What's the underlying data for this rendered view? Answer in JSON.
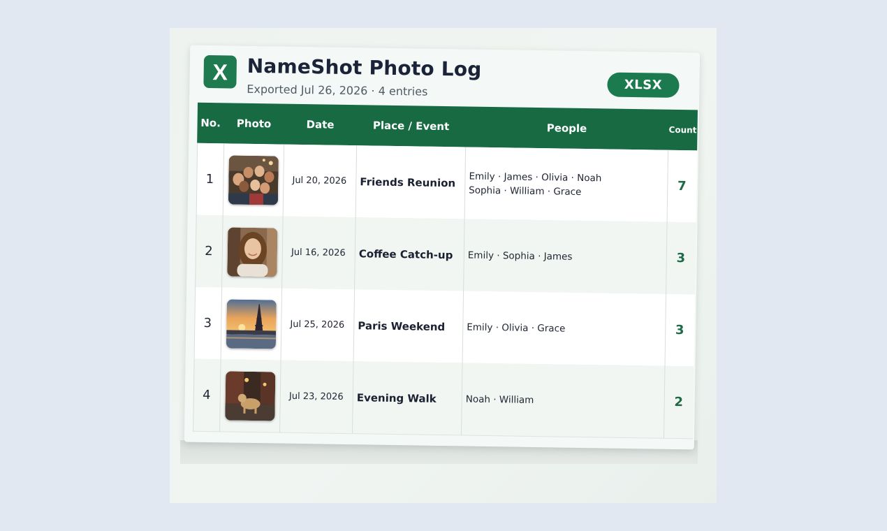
{
  "app": {
    "logo_letter": "X",
    "title": "NameShot Photo Log",
    "subtitle": "Exported Jul 26, 2026 · 4 entries",
    "badge": "XLSX"
  },
  "table": {
    "headers": {
      "no": "No.",
      "photo": "Photo",
      "date": "Date",
      "place": "Place / Event",
      "people": "People",
      "count": "Count"
    },
    "rows": [
      {
        "no": "1",
        "photo": "group-selfie-photo",
        "date": "Jul 20, 2026",
        "place": "Friends Reunion",
        "people": "Emily · James · Olivia · Noah\nSophia · William · Grace",
        "count": "7"
      },
      {
        "no": "2",
        "photo": "woman-portrait-photo",
        "date": "Jul 16, 2026",
        "place": "Coffee Catch-up",
        "people": "Emily · Sophia · James",
        "count": "3"
      },
      {
        "no": "3",
        "photo": "eiffel-tower-sunset-photo",
        "date": "Jul 25, 2026",
        "place": "Paris Weekend",
        "people": "Emily · Olivia · Grace",
        "count": "3"
      },
      {
        "no": "4",
        "photo": "dog-evening-street-photo",
        "date": "Jul 23, 2026",
        "place": "Evening Walk",
        "people": "Noah · William",
        "count": "2"
      }
    ]
  },
  "colors": {
    "brand_green": "#1b7a4e",
    "header_green": "#186a43",
    "count_green": "#1d6b46",
    "page_background": "#e1e8f2"
  }
}
